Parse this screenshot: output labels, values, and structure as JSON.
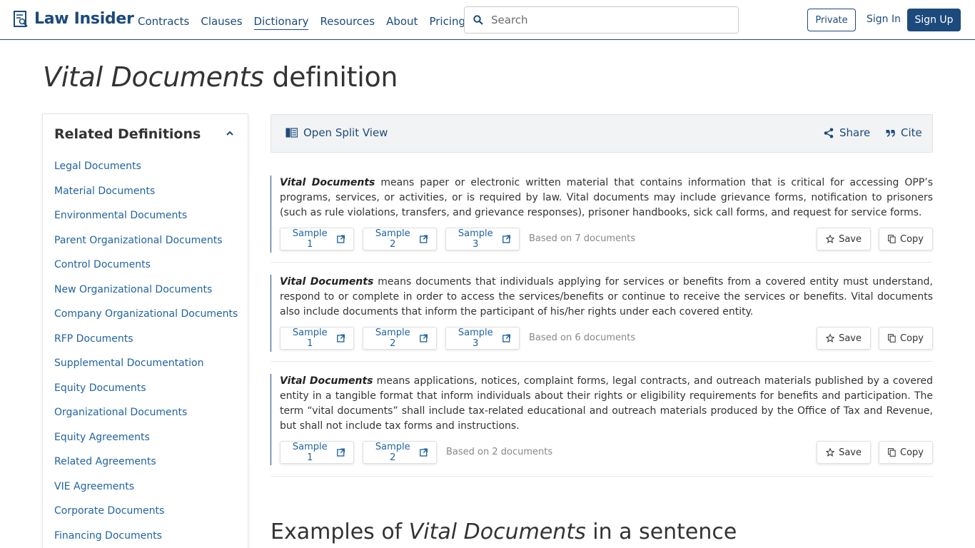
{
  "nav": {
    "logo_text": "Law Insider",
    "links": [
      {
        "label": "Contracts",
        "active": false
      },
      {
        "label": "Clauses",
        "active": false
      },
      {
        "label": "Dictionary",
        "active": true
      },
      {
        "label": "Resources",
        "active": false
      },
      {
        "label": "About",
        "active": false
      },
      {
        "label": "Pricing",
        "active": false
      }
    ],
    "search_placeholder": "Search",
    "private_label": "Private",
    "signin_label": "Sign In",
    "signup_label": "Sign Up"
  },
  "title": {
    "term": "Vital Documents",
    "suffix": "definition"
  },
  "sidebar": {
    "heading": "Related Definitions",
    "items": [
      "Legal Documents",
      "Material Documents",
      "Environmental Documents",
      "Parent Organizational Documents",
      "Control Documents",
      "New Organizational Documents",
      "Company Organizational Documents",
      "RFP Documents",
      "Supplemental Documentation",
      "Equity Documents",
      "Organizational Documents",
      "Equity Agreements",
      "Related Agreements",
      "VIE Agreements",
      "Corporate Documents",
      "Financing Documents"
    ]
  },
  "toolbar": {
    "split_view": "Open Split View",
    "share": "Share",
    "cite": "Cite"
  },
  "definitions": [
    {
      "term": "Vital Documents",
      "text": " means paper or electronic written material that contains information that is critical for accessing OPP’s programs, services, or activities, or is required by law. Vital documents may include grievance forms, notification to prisoners (such as rule violations, transfers, and grievance responses), prisoner handbooks, sick call forms, and request for service forms.",
      "samples": [
        "Sample 1",
        "Sample 2",
        "Sample 3"
      ],
      "based_on": "Based on 7 documents",
      "save": "Save",
      "copy": "Copy"
    },
    {
      "term": "Vital Documents",
      "text": " means documents that individuals applying for services or benefits from a covered entity must understand, respond to or complete in order to access the services/benefits or continue to receive the services or benefits. Vital documents also include documents that inform the participant of his/her rights under each covered entity.",
      "samples": [
        "Sample 1",
        "Sample 2",
        "Sample 3"
      ],
      "based_on": "Based on 6 documents",
      "save": "Save",
      "copy": "Copy"
    },
    {
      "term": "Vital Documents",
      "text": " means applications, notices, complaint forms, legal contracts, and outreach materials published by a covered entity in a tangible format that inform individuals about their rights or eligibility requirements for benefits and participation. The term “vital documents” shall include tax-related educational and outreach materials produced by the Office of Tax and Revenue, but shall not include tax forms and instructions.",
      "samples": [
        "Sample 1",
        "Sample 2"
      ],
      "based_on": "Based on 2 documents",
      "save": "Save",
      "copy": "Copy"
    }
  ],
  "examples": {
    "prefix": "Examples of",
    "term": "Vital Documents",
    "suffix": "in a sentence"
  },
  "colors": {
    "brand": "#1c4a7c",
    "link": "#2163a0"
  }
}
